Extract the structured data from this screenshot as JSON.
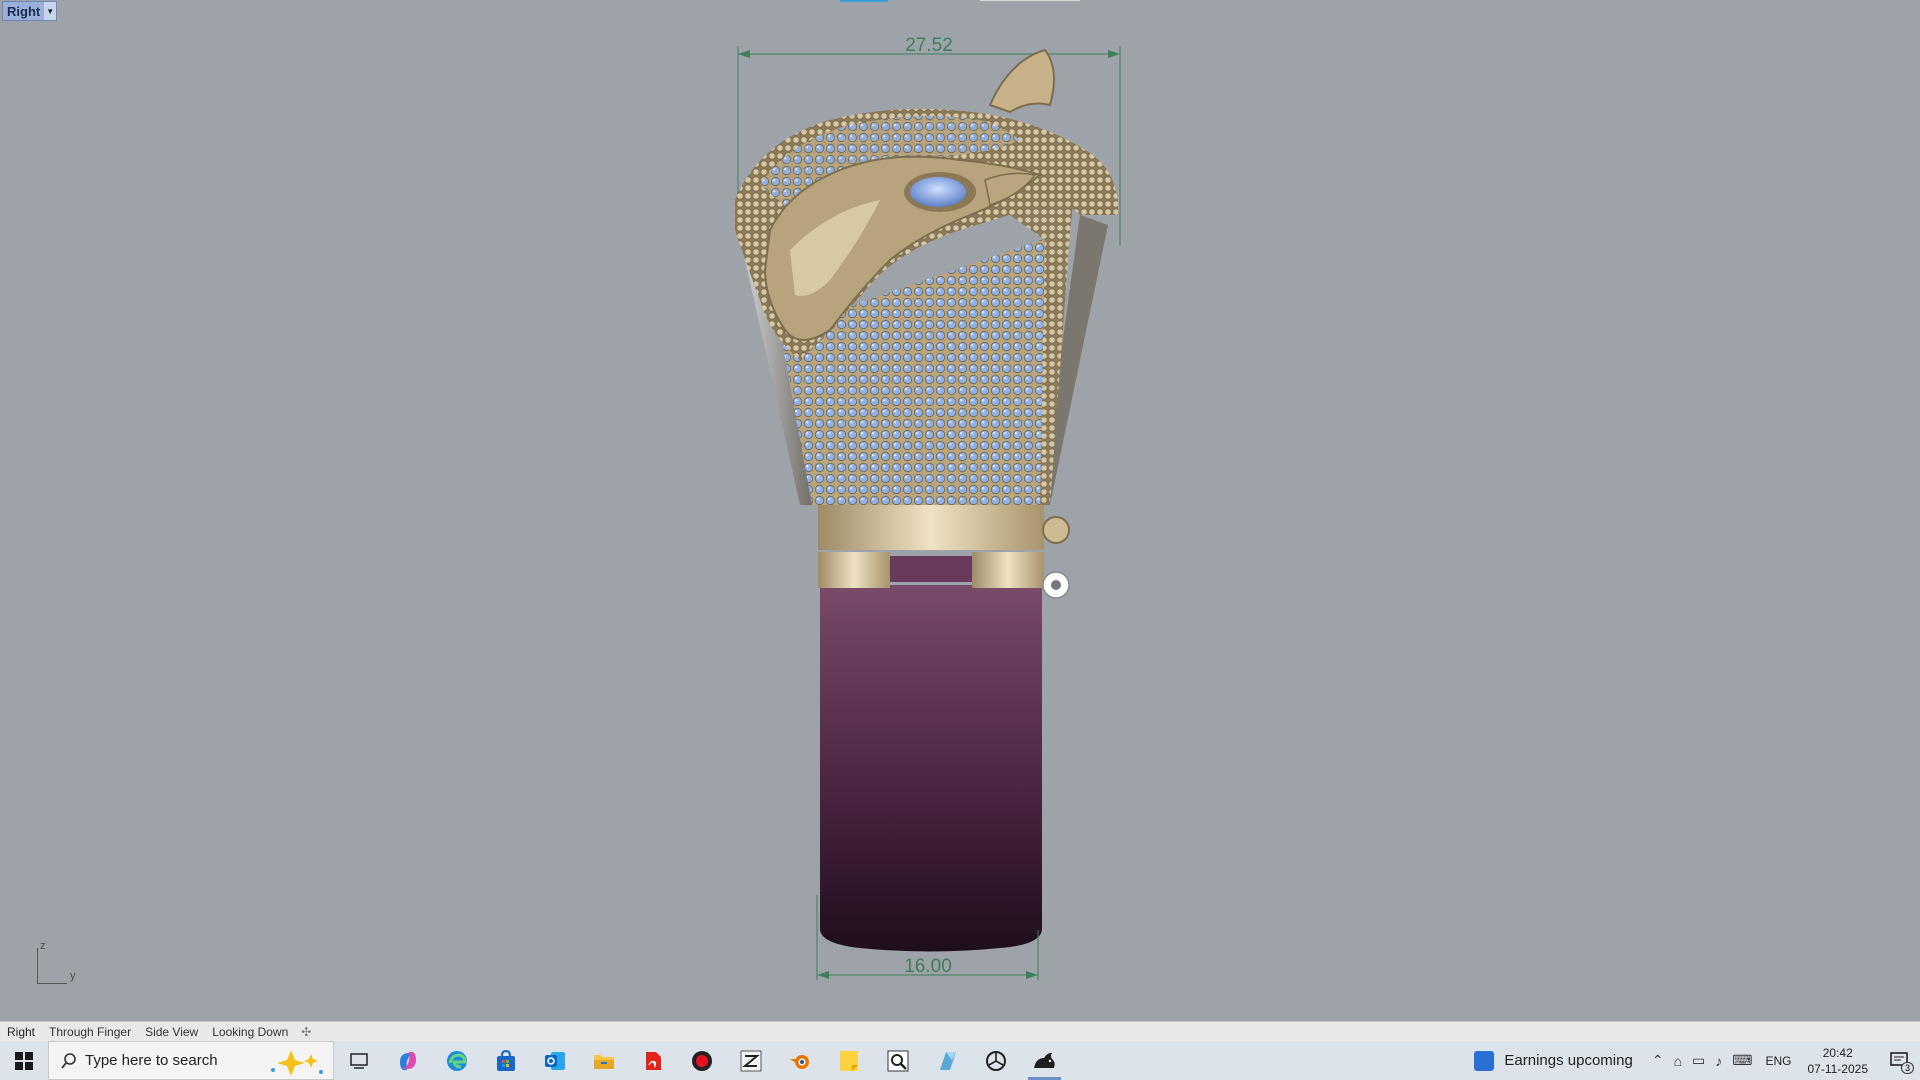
{
  "viewport": {
    "name": "Right",
    "dimension_top": "27.52",
    "dimension_bottom": "16.00",
    "axis_z": "z",
    "axis_y": "y"
  },
  "view_tabs": [
    "Right",
    "Through Finger",
    "Side View",
    "Looking Down"
  ],
  "taskbar": {
    "search_placeholder": "Type here to search",
    "apps": [
      "task-view",
      "copilot",
      "edge",
      "store",
      "outlook",
      "file-explorer",
      "adobe-acrobat",
      "recorder",
      "zbrush",
      "blender",
      "sticky-notes",
      "magnifier",
      "keyshot",
      "chatgpt",
      "rhino"
    ],
    "news": "Earnings upcoming",
    "language": "ENG",
    "time": "20:42",
    "date": "07-11-2025",
    "notification_count": "3"
  },
  "colors": {
    "viewport_bg": "#9ea2a9",
    "gold": "#c8b58e",
    "band": "#5e2e4e",
    "gem": "#8fb0e8",
    "dimension": "#3f7f57"
  }
}
